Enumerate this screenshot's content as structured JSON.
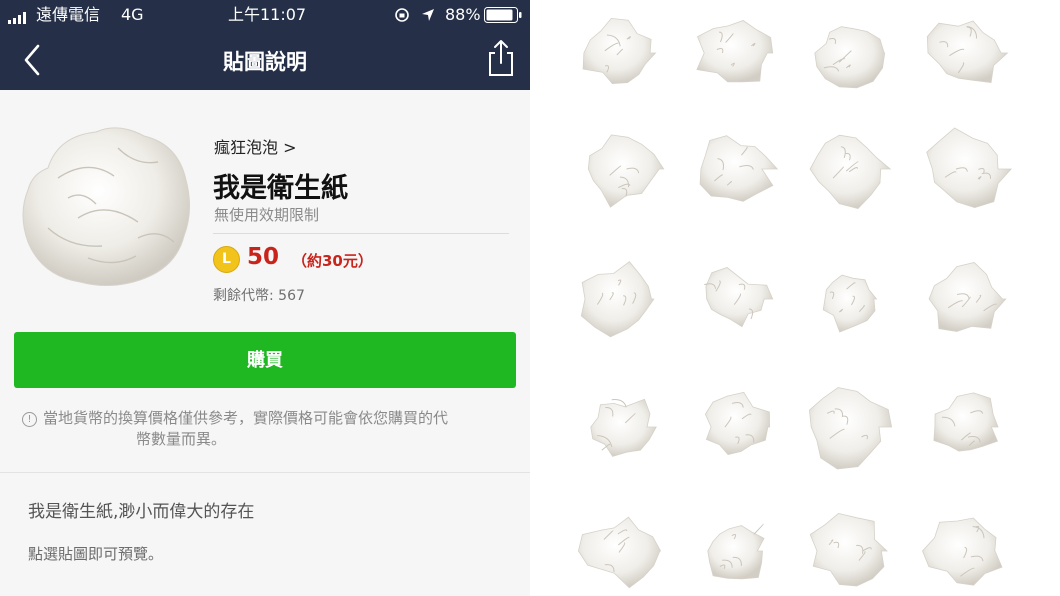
{
  "status_bar": {
    "carrier": "遠傳電信",
    "network": "4G",
    "time": "上午11:07",
    "battery": "88%"
  },
  "nav": {
    "title": "貼圖說明",
    "back_icon": "chevron-left-icon",
    "share_icon": "share-icon"
  },
  "product": {
    "author": "瘋狂泡泡 >",
    "title": "我是衛生紙",
    "validity": "無使用效期限制",
    "coin_symbol": "L",
    "price": "50",
    "price_local": "（約30元）",
    "balance": "剩餘代幣: 567",
    "buy_label": "購買",
    "notice_icon": "!",
    "notice_line1": "當地貨幣的換算價格僅供參考，實際價格可能會依您購買的代",
    "notice_line2": "幣數量而異。"
  },
  "description": {
    "text": "我是衛生紙,渺小而偉大的存在",
    "preview_hint": "點選貼圖即可預覽。"
  },
  "colors": {
    "header": "#252f48",
    "buy_button": "#1fb822",
    "price": "#c8241c",
    "coin": "#f2c31b"
  },
  "sticker_grid": {
    "rows": 5,
    "columns": 4,
    "count": 20
  }
}
